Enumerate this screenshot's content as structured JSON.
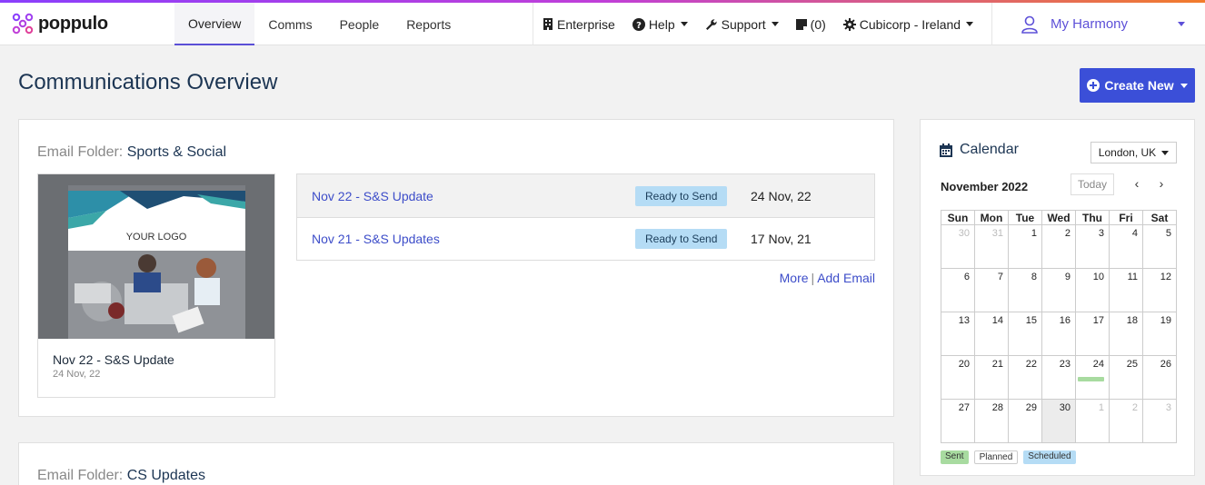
{
  "app": {
    "logo_text": "poppulo",
    "colors": {
      "accent": "#3b4fd8",
      "link": "#3d4dc9",
      "user": "#5d50d8",
      "badge": "#b5dcf5",
      "sent": "#a8dba0"
    }
  },
  "nav": {
    "tabs": [
      {
        "label": "Overview",
        "active": true
      },
      {
        "label": "Comms"
      },
      {
        "label": "People"
      },
      {
        "label": "Reports"
      }
    ],
    "right": {
      "enterprise": "Enterprise",
      "help": "Help",
      "support": "Support",
      "notes": "(0)",
      "tenant": "Cubicorp - Ireland"
    },
    "user": {
      "name": "My Harmony"
    }
  },
  "page": {
    "title": "Communications Overview",
    "create_label": "Create New"
  },
  "folders": [
    {
      "label": "Email Folder:",
      "name": "Sports & Social",
      "thumbnail": {
        "logo_text": "YOUR LOGO",
        "title": "Nov 22 - S&S Update",
        "date": "24 Nov, 22"
      },
      "emails": [
        {
          "title": "Nov 22 - S&S Update",
          "status": "Ready to Send",
          "date": "24 Nov, 22"
        },
        {
          "title": "Nov 21 - S&S Updates",
          "status": "Ready to Send",
          "date": "17 Nov, 21"
        }
      ],
      "more_label": "More",
      "add_label": "Add Email"
    },
    {
      "label": "Email Folder:",
      "name": "CS Updates"
    }
  ],
  "calendar": {
    "title": "Calendar",
    "timezone": "London, UK",
    "month": "November 2022",
    "today_label": "Today",
    "prev_icon": "‹",
    "next_icon": "›",
    "weekdays": [
      "Sun",
      "Mon",
      "Tue",
      "Wed",
      "Thu",
      "Fri",
      "Sat"
    ],
    "weeks": [
      [
        {
          "d": "30",
          "m": true
        },
        {
          "d": "31",
          "m": true
        },
        {
          "d": "1"
        },
        {
          "d": "2"
        },
        {
          "d": "3"
        },
        {
          "d": "4"
        },
        {
          "d": "5"
        }
      ],
      [
        {
          "d": "6"
        },
        {
          "d": "7"
        },
        {
          "d": "8"
        },
        {
          "d": "9"
        },
        {
          "d": "10"
        },
        {
          "d": "11"
        },
        {
          "d": "12"
        }
      ],
      [
        {
          "d": "13"
        },
        {
          "d": "14"
        },
        {
          "d": "15"
        },
        {
          "d": "16"
        },
        {
          "d": "17"
        },
        {
          "d": "18"
        },
        {
          "d": "19"
        }
      ],
      [
        {
          "d": "20"
        },
        {
          "d": "21"
        },
        {
          "d": "22"
        },
        {
          "d": "23"
        },
        {
          "d": "24",
          "sent": true
        },
        {
          "d": "25"
        },
        {
          "d": "26"
        }
      ],
      [
        {
          "d": "27"
        },
        {
          "d": "28"
        },
        {
          "d": "29"
        },
        {
          "d": "30",
          "today": true
        },
        {
          "d": "1",
          "m": true
        },
        {
          "d": "2",
          "m": true
        },
        {
          "d": "3",
          "m": true
        }
      ]
    ],
    "legend": {
      "sent": "Sent",
      "planned": "Planned",
      "scheduled": "Scheduled"
    }
  }
}
